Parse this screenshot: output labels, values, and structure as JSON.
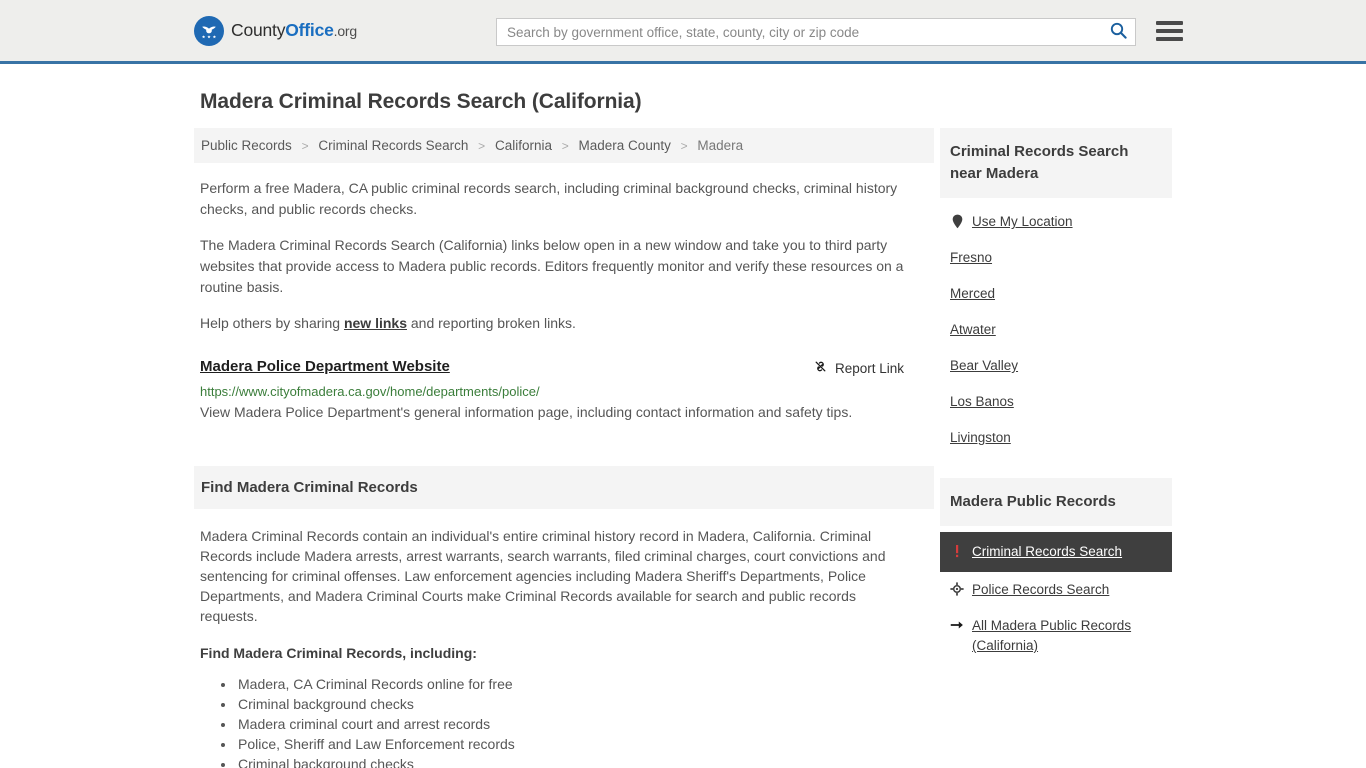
{
  "header": {
    "brand": {
      "part1": "County",
      "part2": "Office",
      "part3": ".org",
      "logo_icon": "eagle-seal-icon"
    },
    "search": {
      "placeholder": "Search by government office, state, county, city or zip code",
      "value": "",
      "icon": "search-icon"
    },
    "menu_icon": "hamburger-menu-icon",
    "accent_color": "#3873a5"
  },
  "page": {
    "title": "Madera Criminal Records Search (California)"
  },
  "breadcrumb": {
    "items": [
      {
        "label": "Public Records",
        "current": false
      },
      {
        "label": "Criminal Records Search",
        "current": false
      },
      {
        "label": "California",
        "current": false
      },
      {
        "label": "Madera County",
        "current": false
      },
      {
        "label": "Madera",
        "current": true
      }
    ],
    "separator": ">"
  },
  "intro": {
    "p1": "Perform a free Madera, CA public criminal records search, including criminal background checks, criminal history checks, and public records checks.",
    "p2": "The Madera Criminal Records Search (California) links below open in a new window and take you to third party websites that provide access to Madera public records. Editors frequently monitor and verify these resources on a routine basis.",
    "p3_before": "Help others by sharing ",
    "p3_link": "new links",
    "p3_after": " and reporting broken links."
  },
  "result": {
    "title": "Madera Police Department Website",
    "report_label": "Report Link",
    "report_icon": "broken-link-icon",
    "url": "https://www.cityofmadera.ca.gov/home/departments/police/",
    "description": "View Madera Police Department's general information page, including contact information and safety tips."
  },
  "find_section": {
    "heading": "Find Madera Criminal Records",
    "paragraph": "Madera Criminal Records contain an individual's entire criminal history record in Madera, California. Criminal Records include Madera arrests, arrest warrants, search warrants, filed criminal charges, court convictions and sentencing for criminal offenses. Law enforcement agencies including Madera Sheriff's Departments, Police Departments, and Madera Criminal Courts make Criminal Records available for search and public records requests.",
    "list_heading": "Find Madera Criminal Records, including:",
    "items": [
      "Madera, CA Criminal Records online for free",
      "Criminal background checks",
      "Madera criminal court and arrest records",
      "Police, Sheriff and Law Enforcement records",
      "Criminal background checks"
    ]
  },
  "sidebar": {
    "nearby": {
      "heading": "Criminal Records Search near Madera",
      "items": [
        {
          "label": "Use My Location",
          "icon": "location-pin-icon"
        },
        {
          "label": "Fresno",
          "icon": ""
        },
        {
          "label": "Merced",
          "icon": ""
        },
        {
          "label": "Atwater",
          "icon": ""
        },
        {
          "label": "Bear Valley",
          "icon": ""
        },
        {
          "label": "Los Banos",
          "icon": ""
        },
        {
          "label": "Livingston",
          "icon": ""
        }
      ]
    },
    "public_records": {
      "heading": "Madera Public Records",
      "items": [
        {
          "label": "Criminal Records Search",
          "icon": "exclamation-icon",
          "active": true
        },
        {
          "label": "Police Records Search",
          "icon": "crosshair-badge-icon",
          "active": false
        },
        {
          "label": "All Madera Public Records (California)",
          "icon": "arrow-right-icon",
          "active": false
        }
      ]
    },
    "active_bg": "#3f3f3f",
    "alert_color": "#d63c3c"
  }
}
